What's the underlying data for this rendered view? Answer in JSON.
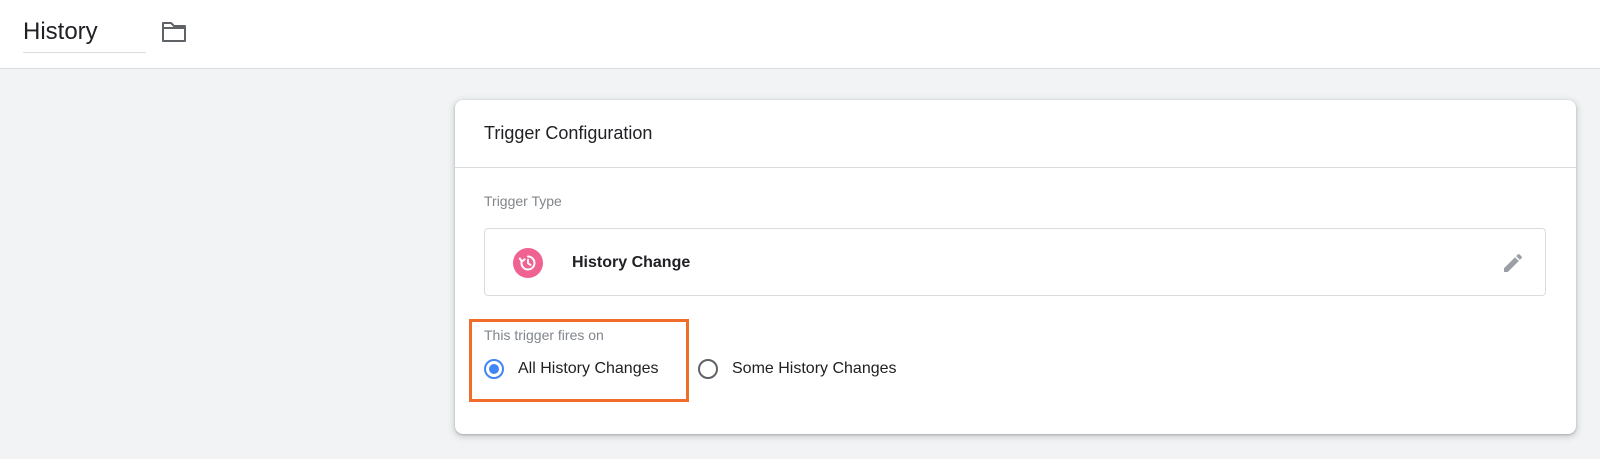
{
  "header": {
    "title": "History",
    "folder_icon": "folder-icon"
  },
  "card": {
    "title": "Trigger Configuration",
    "trigger_type_label": "Trigger Type",
    "trigger_type": {
      "name": "History Change",
      "icon": "history-icon",
      "icon_color": "#f06292",
      "edit_icon": "pencil-icon"
    },
    "fires_on_label": "This trigger fires on",
    "fires_on_options": [
      {
        "label": "All History Changes",
        "selected": true
      },
      {
        "label": "Some History Changes",
        "selected": false
      }
    ]
  },
  "colors": {
    "accent": "#4285f4",
    "highlight": "#ef6c2a",
    "background": "#f1f3f4"
  }
}
